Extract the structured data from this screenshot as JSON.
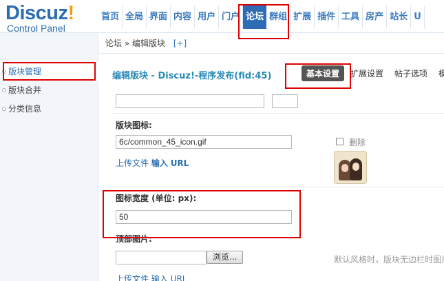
{
  "header": {
    "logo_text": "Discuz",
    "logo_bang": "!",
    "logo_sub": "Control Panel",
    "nav": [
      "首页",
      "全局",
      "界面",
      "内容",
      "用户",
      "门户",
      "论坛",
      "群组",
      "扩展",
      "插件",
      "工具",
      "房产",
      "站长",
      "U"
    ],
    "active_nav": "论坛"
  },
  "breadcrumb": {
    "text": "论坛 » 编辑版块",
    "plus": "[+]"
  },
  "sidebar": {
    "items": [
      {
        "label": "版块管理",
        "active": true
      },
      {
        "label": "版块合并",
        "active": false
      },
      {
        "label": "分类信息",
        "active": false
      }
    ]
  },
  "main": {
    "title": "编辑版块 - Discuz!-程序发布(fid:45)",
    "tabs": [
      {
        "label": "基本设置",
        "active": true
      },
      {
        "label": "扩展设置",
        "active": false
      },
      {
        "label": "帖子选项",
        "active": false
      },
      {
        "label": "模",
        "active": false
      }
    ],
    "icon_section": {
      "label": "版块图标:",
      "value": "6c/common_45_icon.gif",
      "upload_link": "上传文件",
      "input_label": "输入",
      "url_label": "URL",
      "delete_label": "删除"
    },
    "icon_width": {
      "label": "图标宽度 (单位: px):",
      "value": "50"
    },
    "top_image": {
      "label": "顶部图片:",
      "browse_label": "浏览...",
      "upload_link": "上传文件",
      "input_label": "输入",
      "url_label": "URL",
      "hint": "默认风格时，版块无边栏时图片"
    }
  },
  "colors": {
    "accent": "#2b6eb2",
    "title": "#2b8bb8",
    "annotation": "#e00000"
  }
}
